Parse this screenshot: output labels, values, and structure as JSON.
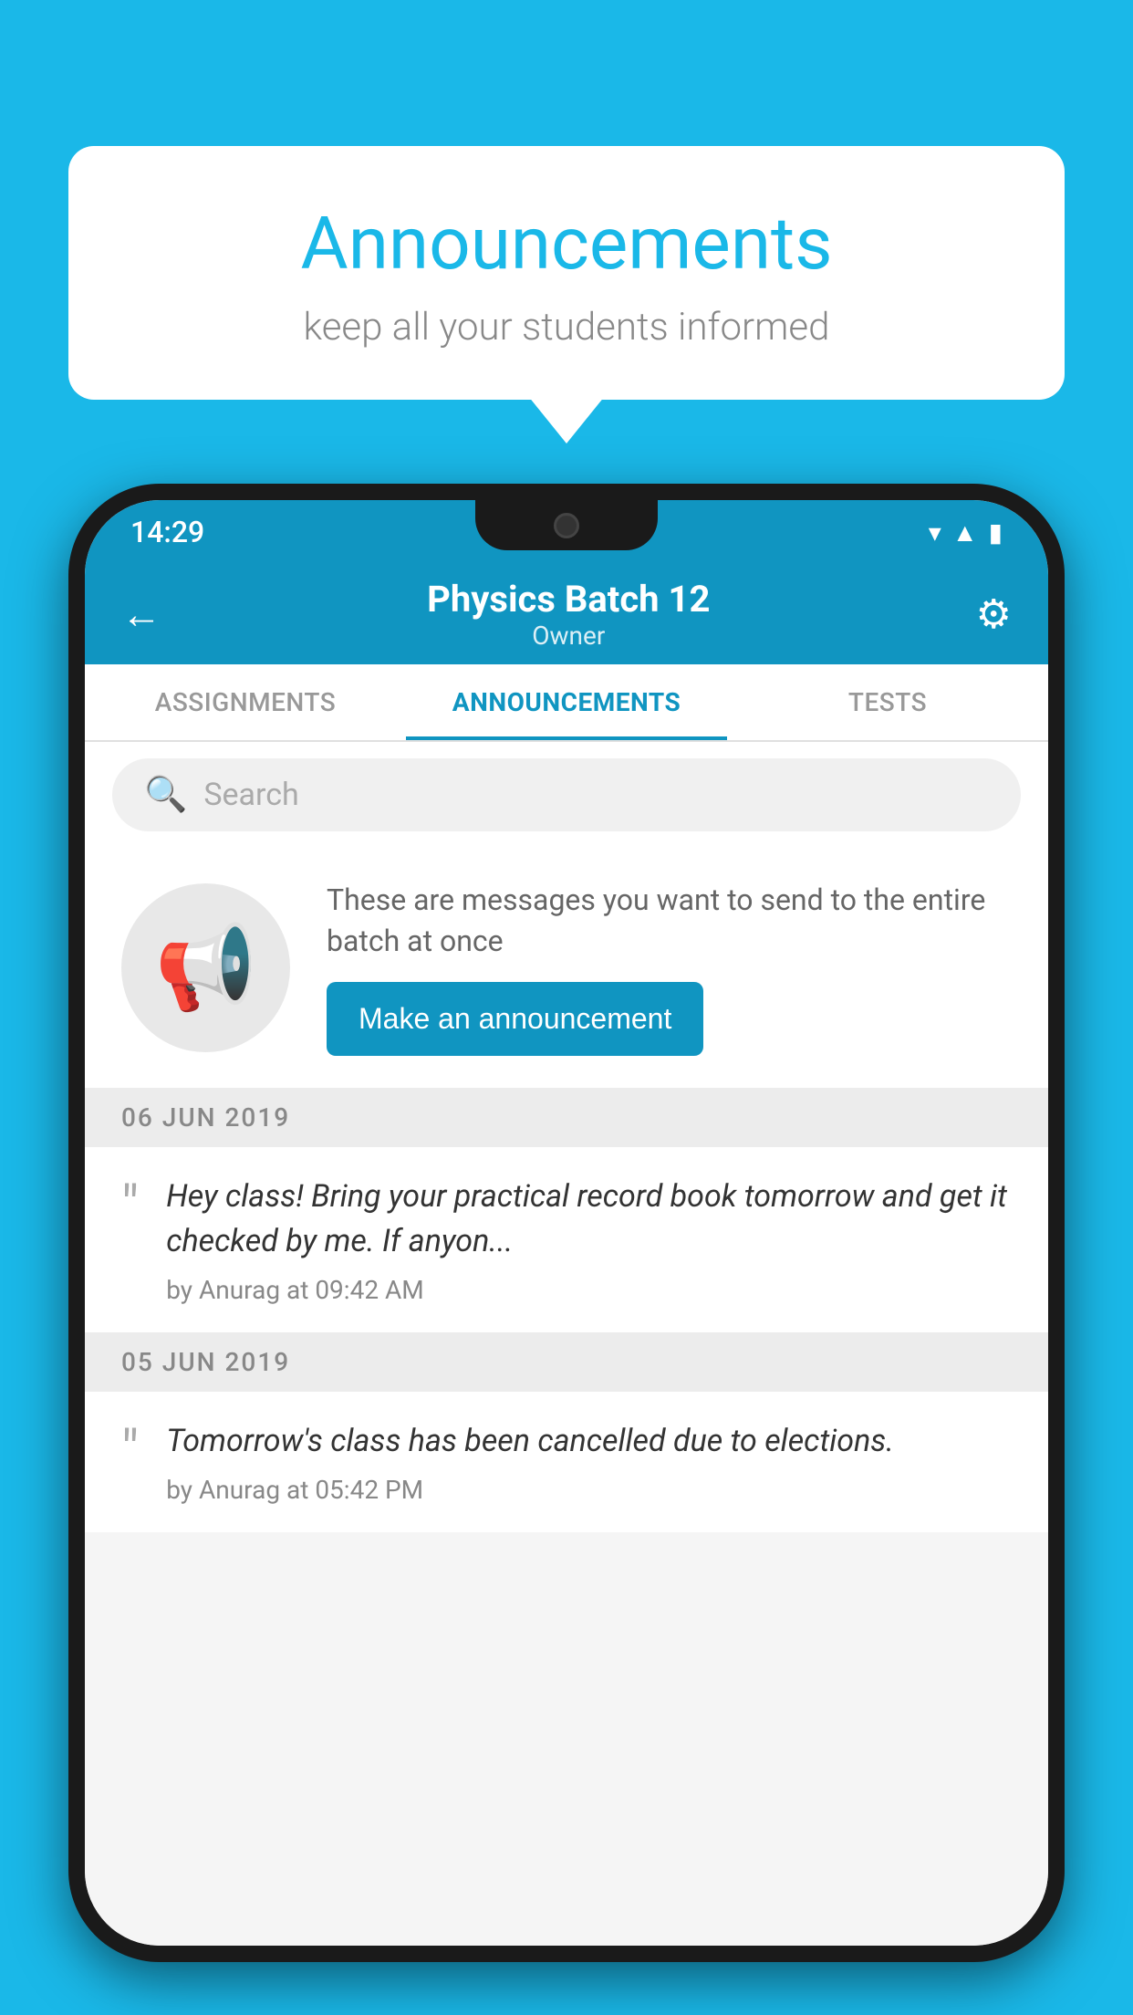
{
  "page": {
    "background_color": "#1ab8e8"
  },
  "speech_bubble": {
    "title": "Announcements",
    "subtitle": "keep all your students informed"
  },
  "status_bar": {
    "time": "14:29",
    "wifi_icon": "▼",
    "signal_icon": "▲",
    "battery_icon": "▮"
  },
  "header": {
    "back_icon": "←",
    "title": "Physics Batch 12",
    "subtitle": "Owner",
    "settings_icon": "⚙"
  },
  "tabs": [
    {
      "label": "ASSIGNMENTS",
      "active": false
    },
    {
      "label": "ANNOUNCEMENTS",
      "active": true
    },
    {
      "label": "TESTS",
      "active": false
    }
  ],
  "search": {
    "placeholder": "Search"
  },
  "promo": {
    "description": "These are messages you want to send to the entire batch at once",
    "button_label": "Make an announcement"
  },
  "announcements": [
    {
      "date": "06  JUN  2019",
      "text": "Hey class! Bring your practical record book tomorrow and get it checked by me. If anyon...",
      "meta": "by Anurag at 09:42 AM"
    },
    {
      "date": "05  JUN  2019",
      "text": "Tomorrow's class has been cancelled due to elections.",
      "meta": "by Anurag at 05:42 PM"
    }
  ]
}
